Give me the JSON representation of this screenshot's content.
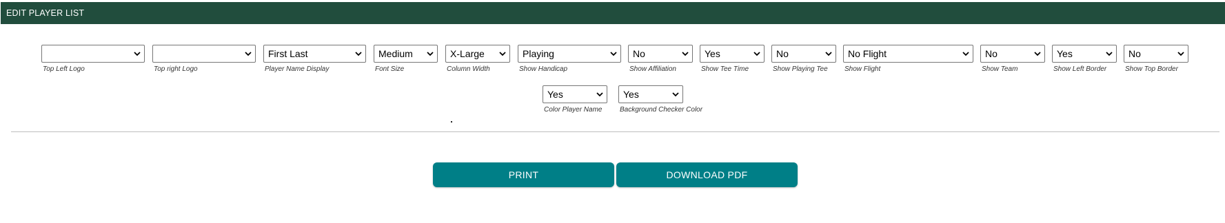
{
  "header": {
    "title": "EDIT PLAYER LIST",
    "bg_color": "#214d3d"
  },
  "fields": [
    {
      "value": "",
      "label": "Top Left Logo"
    },
    {
      "value": "",
      "label": "Top right Logo"
    },
    {
      "value": "First Last",
      "label": "Player Name Display"
    },
    {
      "value": "Medium",
      "label": "Font Size"
    },
    {
      "value": "X-Large",
      "label": "Column Width"
    },
    {
      "value": "Playing",
      "label": "Show Handicap"
    },
    {
      "value": "No",
      "label": "Show Affiliation"
    },
    {
      "value": "Yes",
      "label": "Show Tee Time"
    },
    {
      "value": "No",
      "label": "Show Playing Tee"
    },
    {
      "value": "No Flight",
      "label": "Show Flight"
    },
    {
      "value": "No",
      "label": "Show Team"
    },
    {
      "value": "Yes",
      "label": "Show Left Border"
    },
    {
      "value": "No",
      "label": "Show Top Border"
    },
    {
      "value": "Yes",
      "label": "Color Player Name"
    },
    {
      "value": "Yes",
      "label": "Background Checker Color"
    }
  ],
  "buttons": {
    "print": "PRINT",
    "download_pdf": "DOWNLOAD PDF",
    "color": "#007f87"
  }
}
